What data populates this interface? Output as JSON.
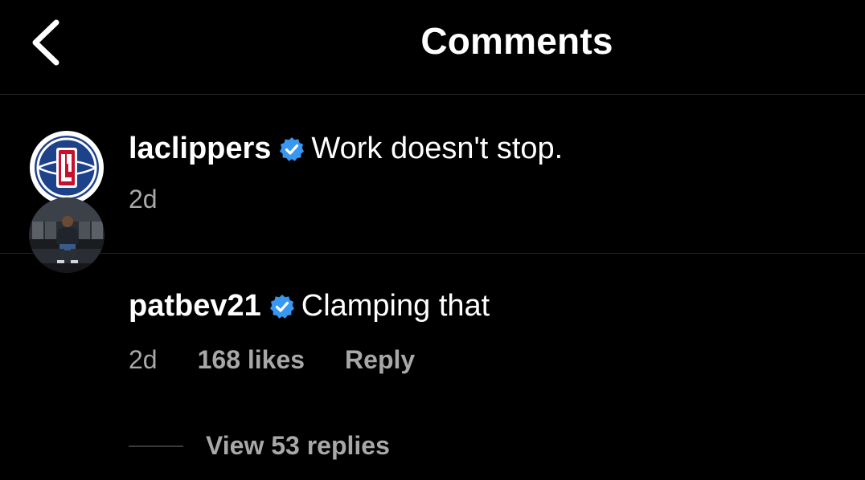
{
  "header": {
    "title": "Comments",
    "back_icon": "chevron-left-icon"
  },
  "caption": {
    "username": "laclippers",
    "verified": true,
    "text": "Work doesn't stop.",
    "time": "2d",
    "avatar": "clippers-logo"
  },
  "comments": [
    {
      "username": "patbev21",
      "verified": true,
      "text": "Clamping that",
      "time": "2d",
      "likes": "168 likes",
      "reply_label": "Reply",
      "view_replies": "View 53 replies",
      "avatar": "player-photo"
    }
  ],
  "colors": {
    "background": "#000000",
    "text": "#ffffff",
    "secondary_text": "#a8a8a8",
    "verified_badge": "#3897f0",
    "divider": "#262626"
  }
}
